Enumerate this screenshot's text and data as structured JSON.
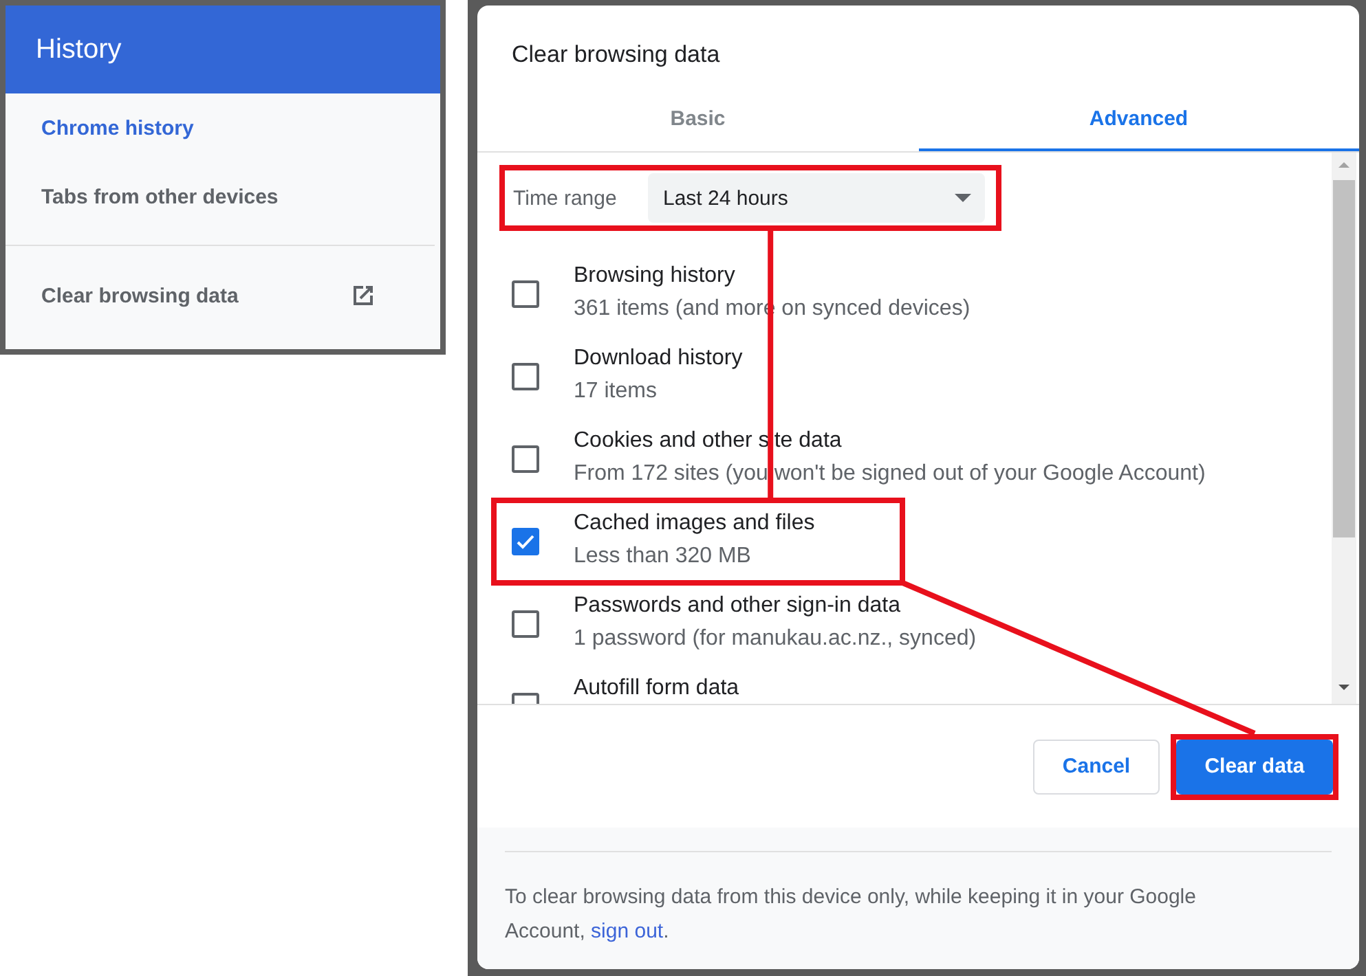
{
  "sidebar": {
    "title": "History",
    "items": [
      {
        "label": "Chrome history",
        "selected": true
      },
      {
        "label": "Tabs from other devices",
        "selected": false
      },
      {
        "label": "Clear browsing data",
        "selected": false,
        "kind": "external"
      }
    ]
  },
  "dialog": {
    "title": "Clear browsing data",
    "tabs": [
      {
        "label": "Basic",
        "selected": false
      },
      {
        "label": "Advanced",
        "selected": true
      }
    ],
    "time_range": {
      "label": "Time range",
      "value": "Last 24 hours",
      "highlighted": true
    },
    "options": [
      {
        "title": "Browsing history",
        "detail": "361 items (and more on synced devices)",
        "checked": false,
        "highlighted": false
      },
      {
        "title": "Download history",
        "detail": "17 items",
        "checked": false,
        "highlighted": false
      },
      {
        "title": "Cookies and other site data",
        "detail": "From 172 sites (you won't be signed out of your Google Account)",
        "checked": false,
        "highlighted": false
      },
      {
        "title": "Cached images and files",
        "detail": "Less than 320 MB",
        "checked": true,
        "highlighted": true
      },
      {
        "title": "Passwords and other sign-in data",
        "detail": "1 password (for manukau.ac.nz., synced)",
        "checked": false,
        "highlighted": false
      },
      {
        "title": "Autofill form data",
        "checked": false,
        "highlighted": false
      }
    ],
    "buttons": [
      {
        "label": "Cancel",
        "kind": "secondary",
        "highlighted": false
      },
      {
        "label": "Clear data",
        "kind": "primary",
        "highlighted": true
      }
    ],
    "footer": {
      "text_before": "To clear browsing data from this device only, while keeping it in your Google Account, ",
      "link": "sign out",
      "text_after": "."
    }
  }
}
